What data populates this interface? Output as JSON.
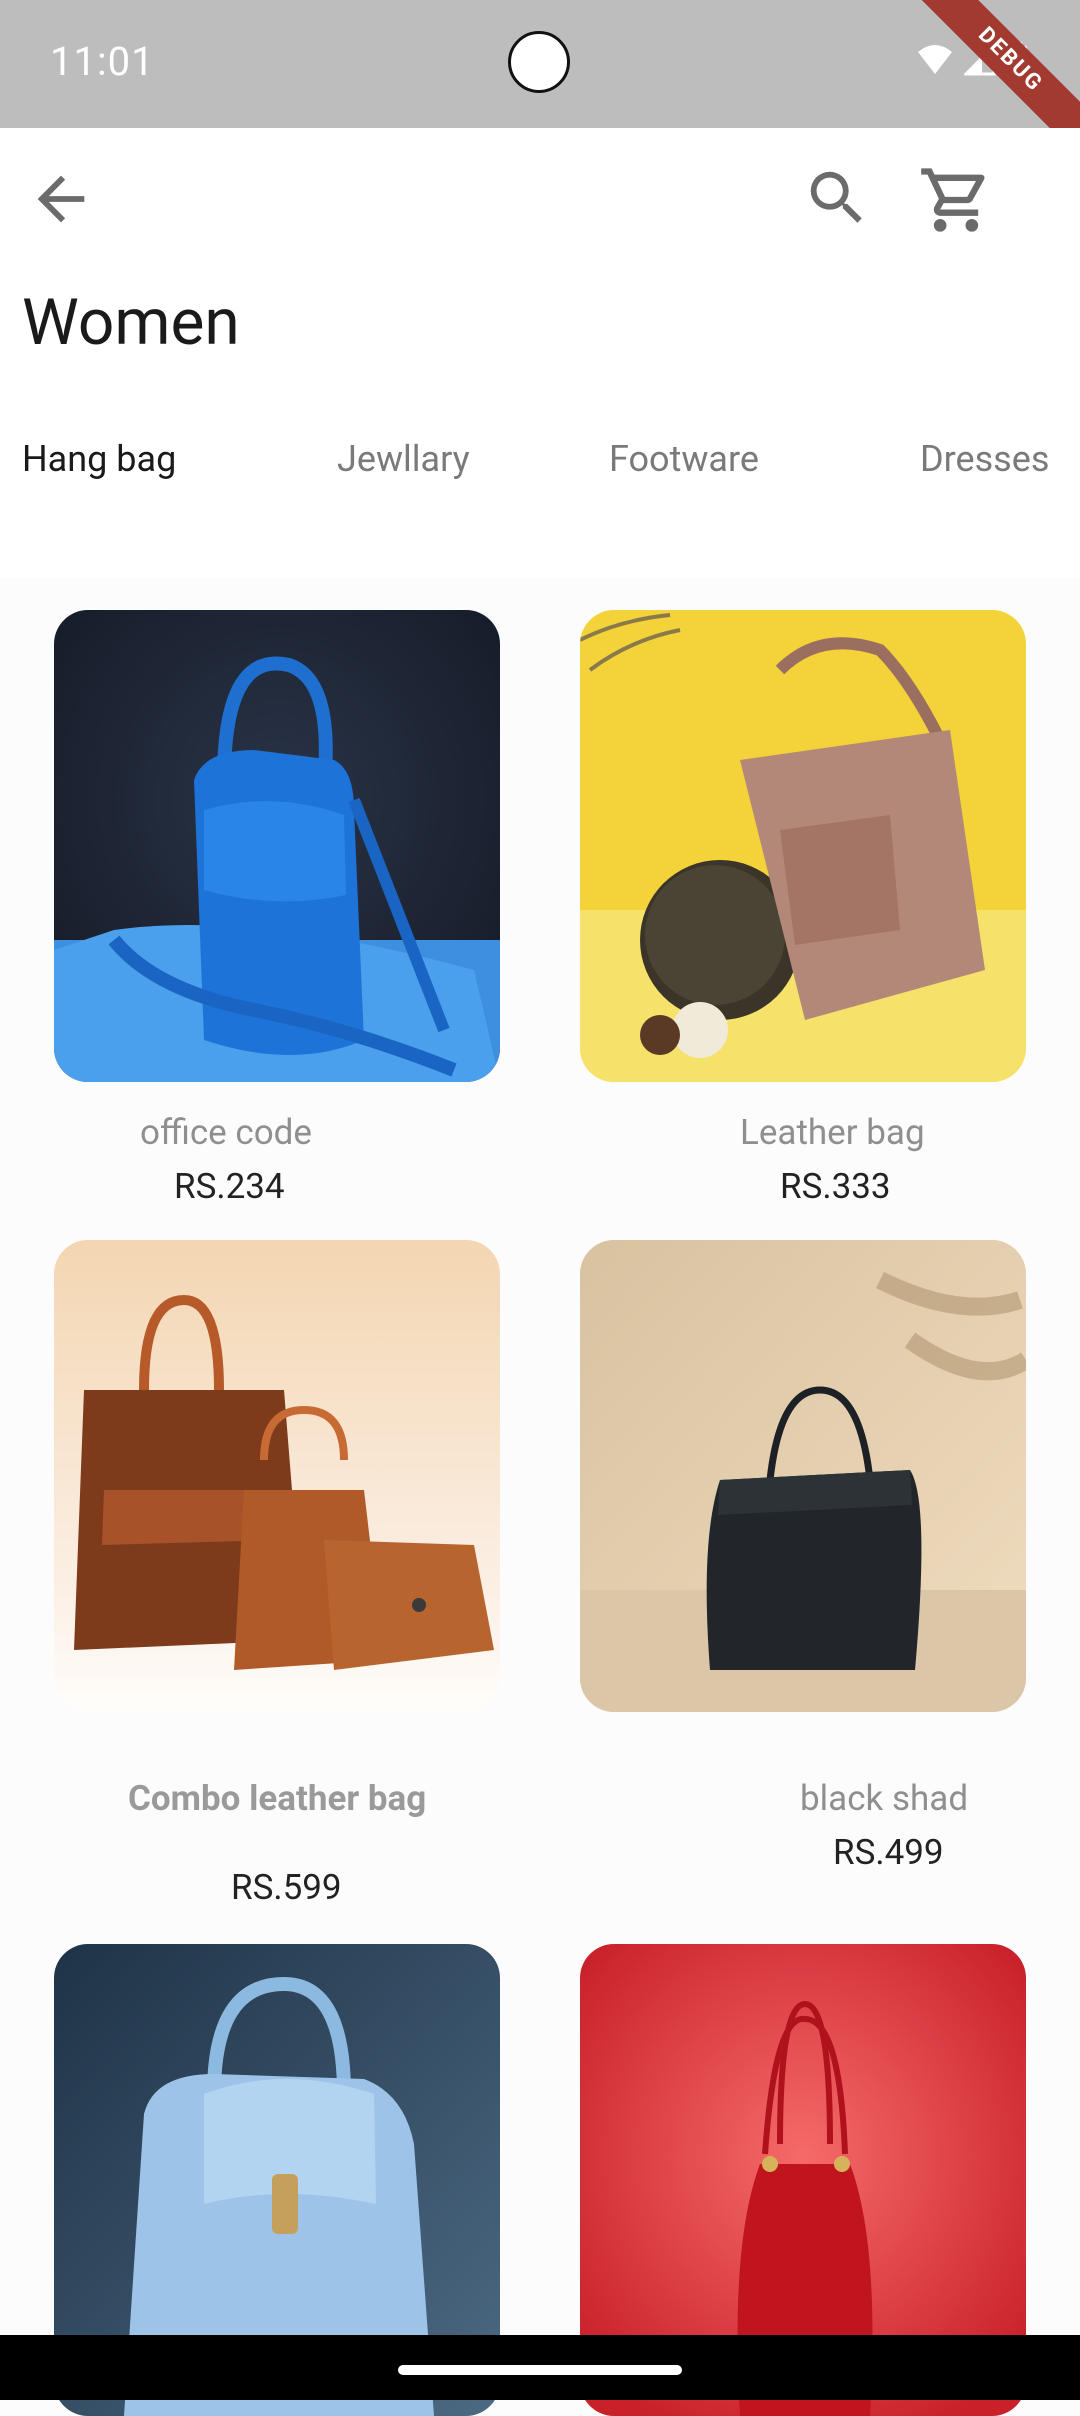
{
  "status_bar": {
    "time": "11:01",
    "debug_label": "DEBUG"
  },
  "app_bar": {
    "icons": {
      "back": "arrow-back-icon",
      "search": "search-icon",
      "cart": "shopping-cart-icon"
    }
  },
  "page": {
    "title": "Women"
  },
  "tabs": [
    {
      "label": "Hang bag",
      "active": true
    },
    {
      "label": "Jewllary",
      "active": false
    },
    {
      "label": "Footware",
      "active": false
    },
    {
      "label": "Dresses",
      "active": false
    }
  ],
  "products": [
    {
      "name": "office code",
      "price": "RS.234"
    },
    {
      "name": "Leather bag",
      "price": "RS.333"
    },
    {
      "name": "Combo leather bag",
      "price": "RS.599"
    },
    {
      "name": "black shad",
      "price": "RS.499"
    },
    {
      "name": "",
      "price": ""
    },
    {
      "name": "",
      "price": ""
    }
  ],
  "colors": {
    "status_bar": "#bdbdbd",
    "debug_ribbon": "#a33a2f",
    "accent_text": "#1a1a1a",
    "muted_text": "#7a7a7a"
  }
}
